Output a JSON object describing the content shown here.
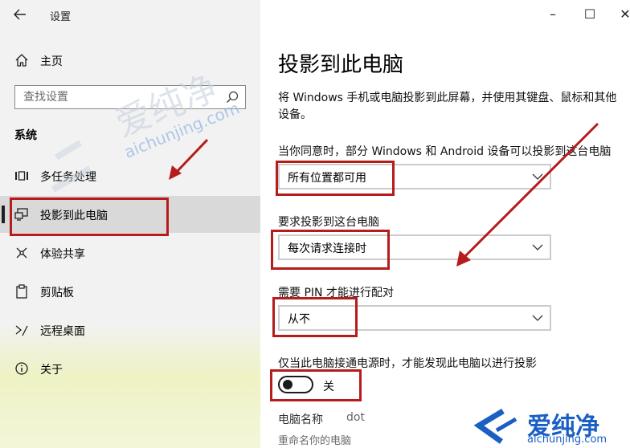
{
  "window": {
    "app_title": "设置",
    "back_icon": "arrow-left-icon",
    "controls": {
      "minimize": "–",
      "maximize": "☐",
      "close": "✕"
    }
  },
  "sidebar": {
    "home_label": "主页",
    "search_placeholder": "查找设置",
    "section_title": "系统",
    "items": [
      {
        "label": "多任务处理",
        "icon": "multitask-icon"
      },
      {
        "label": "投影到此电脑",
        "icon": "project-pc-icon",
        "selected": true
      },
      {
        "label": "体验共享",
        "icon": "share-icon"
      },
      {
        "label": "剪贴板",
        "icon": "clipboard-icon"
      },
      {
        "label": "远程桌面",
        "icon": "remote-desktop-icon"
      },
      {
        "label": "关于",
        "icon": "info-icon"
      }
    ]
  },
  "main": {
    "title": "投影到此电脑",
    "description": "将 Windows 手机或电脑投影到此屏幕，并使用其键盘、鼠标和其他设备。",
    "settings": [
      {
        "label": "当你同意时，部分 Windows 和 Android 设备可以投影到这台电脑",
        "value": "所有位置都可用"
      },
      {
        "label": "要求投影到这台电脑",
        "value": "每次请求连接时"
      },
      {
        "label": "需要 PIN 才能进行配对",
        "value": "从不"
      }
    ],
    "power_label": "仅当此电脑接通电源时，才能发现此电脑以进行投影",
    "toggle_state": "关",
    "pc_name_label": "电脑名称",
    "pc_name_value": "dot",
    "rename_link": "重命名你的电脑"
  },
  "watermark": {
    "brand": "爱纯净",
    "url": "aichunjing.com",
    "colors": {
      "blue": "#1a5fc4",
      "faint": "#c9d2df",
      "red": "#b51c1c"
    }
  }
}
